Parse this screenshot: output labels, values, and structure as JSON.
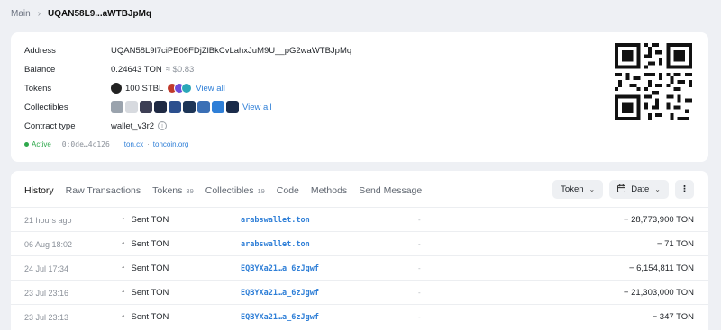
{
  "breadcrumb": {
    "main": "Main",
    "current": "UQAN58L9...aWTBJpMq"
  },
  "info": {
    "address_label": "Address",
    "address": "UQAN58L9l7ciPE06FDjZlBkCvLahxJuM9U__pG2waWTBJpMq",
    "balance_label": "Balance",
    "balance": "0.24643 TON",
    "balance_fiat": "≈ $0.83",
    "tokens_label": "Tokens",
    "tokens_value": "100 STBL",
    "tokens_view_all": "View all",
    "collectibles_label": "Collectibles",
    "collectibles_view_all": "View all",
    "contract_label": "Contract type",
    "contract_type": "wallet_v3r2",
    "status": "Active",
    "hash": "0:0de…4c126",
    "ext_link_1": "ton.cx",
    "ext_link_2": "toncoin.org"
  },
  "colors": {
    "accent": "#2f7fd7",
    "active": "#2ea84b",
    "muted": "#8a9099"
  },
  "tabs": [
    {
      "label": "History",
      "count": ""
    },
    {
      "label": "Raw Transactions",
      "count": ""
    },
    {
      "label": "Tokens",
      "count": "39"
    },
    {
      "label": "Collectibles",
      "count": "19"
    },
    {
      "label": "Code",
      "count": ""
    },
    {
      "label": "Methods",
      "count": ""
    },
    {
      "label": "Send Message",
      "count": ""
    }
  ],
  "filters": {
    "token": "Token",
    "date": "Date",
    "more": "⋮"
  },
  "transactions": [
    {
      "time": "21 hours ago",
      "action": "Sent TON",
      "address": "arabswallet.ton",
      "message": "-",
      "amount": "− 28,773,900 TON"
    },
    {
      "time": "06 Aug 18:02",
      "action": "Sent TON",
      "address": "arabswallet.ton",
      "message": "-",
      "amount": "− 71 TON"
    },
    {
      "time": "24 Jul 17:34",
      "action": "Sent TON",
      "address": "EQBYXa21…a_6zJgwf",
      "message": "-",
      "amount": "− 6,154,811 TON"
    },
    {
      "time": "23 Jul 23:16",
      "action": "Sent TON",
      "address": "EQBYXa21…a_6zJgwf",
      "message": "-",
      "amount": "− 21,303,000 TON"
    },
    {
      "time": "23 Jul 23:13",
      "action": "Sent TON",
      "address": "EQBYXa21…a_6zJgwf",
      "message": "-",
      "amount": "− 347 TON"
    }
  ]
}
